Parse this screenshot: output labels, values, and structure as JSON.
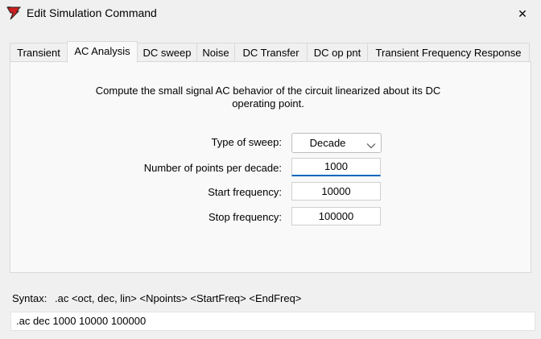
{
  "window": {
    "title": "Edit Simulation Command",
    "close_glyph": "✕"
  },
  "tabs": [
    {
      "label": "Transient"
    },
    {
      "label": "AC Analysis",
      "active": true
    },
    {
      "label": "DC sweep"
    },
    {
      "label": "Noise"
    },
    {
      "label": "DC Transfer"
    },
    {
      "label": "DC op pnt"
    },
    {
      "label": "Transient Frequency Response"
    }
  ],
  "panel": {
    "description": "Compute the small signal AC behavior of the circuit linearized about its DC operating point.",
    "sweep_type": {
      "label": "Type of sweep:",
      "value": "Decade"
    },
    "points": {
      "label": "Number of points per decade:",
      "value": "1000"
    },
    "start_freq": {
      "label": "Start frequency:",
      "value": "10000"
    },
    "stop_freq": {
      "label": "Stop frequency:",
      "value": "100000"
    }
  },
  "syntax": {
    "label": "Syntax:",
    "text": ".ac <oct, dec, lin> <Npoints> <StartFreq> <EndFreq>"
  },
  "command": {
    "value": ".ac dec 1000 10000 100000"
  },
  "colors": {
    "accent": "#0067c0",
    "icon_red": "#cc1f1f"
  },
  "icons": {
    "app": "ltspice-app-icon",
    "close": "close-icon",
    "dropdown": "chevron-down-icon"
  }
}
